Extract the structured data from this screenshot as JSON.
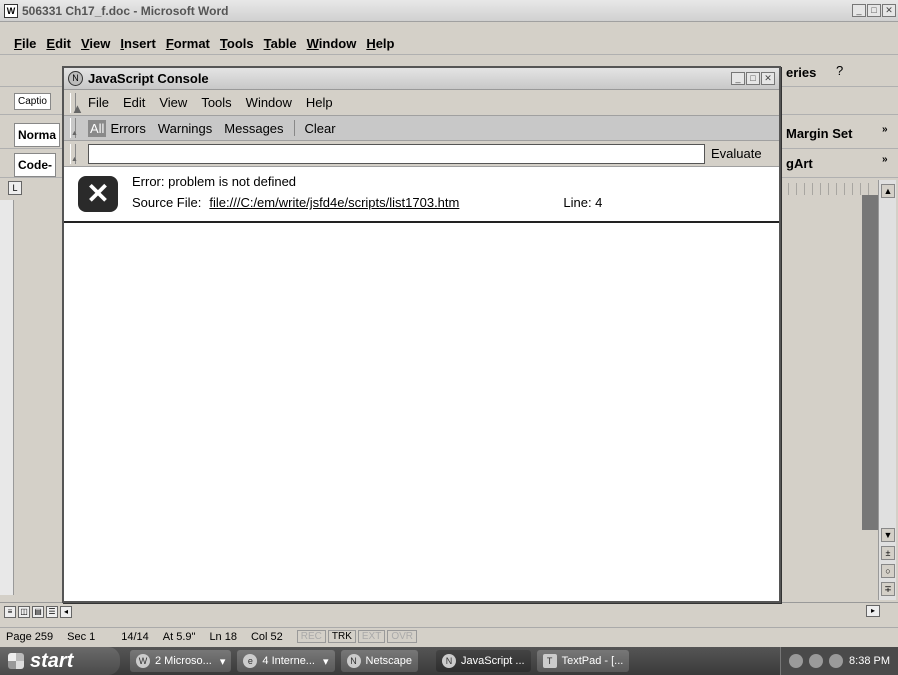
{
  "word": {
    "title": "506331 Ch17_f.doc - Microsoft Word",
    "menu": [
      "File",
      "Edit",
      "View",
      "Insert",
      "Format",
      "Tools",
      "Table",
      "Window",
      "Help"
    ],
    "toolbar_caption": "Captio",
    "style_box": "Norma",
    "style_box2": "Code-",
    "right_queries": "eries",
    "right_margin_set": "Margin Set",
    "right_wordart": "gArt",
    "ruler_corner": "L",
    "status": {
      "page": "Page 259",
      "sec": "Sec 1",
      "pages": "14/14",
      "at": "At 5.9\"",
      "ln": "Ln 18",
      "col": "Col 52",
      "rec": "REC",
      "trk": "TRK",
      "ext": "EXT",
      "ovr": "OVR"
    }
  },
  "console": {
    "title": "JavaScript Console",
    "menu": [
      "File",
      "Edit",
      "View",
      "Tools",
      "Window",
      "Help"
    ],
    "filters": {
      "all": "All",
      "errors": "Errors",
      "warnings": "Warnings",
      "messages": "Messages",
      "clear": "Clear"
    },
    "eval_value": "",
    "evaluate": "Evaluate",
    "error": {
      "message": "Error:  problem is not defined",
      "source_label": "Source File:",
      "source_url": "file:///C:/em/write/jsfd4e/scripts/list1703.htm",
      "line_label": "Line:  4"
    }
  },
  "taskbar": {
    "start": "start",
    "tasks": [
      "2 Microso...",
      "4 Interne...",
      "Netscape",
      "JavaScript ...",
      "TextPad - [..."
    ],
    "clock": "8:38 PM"
  }
}
